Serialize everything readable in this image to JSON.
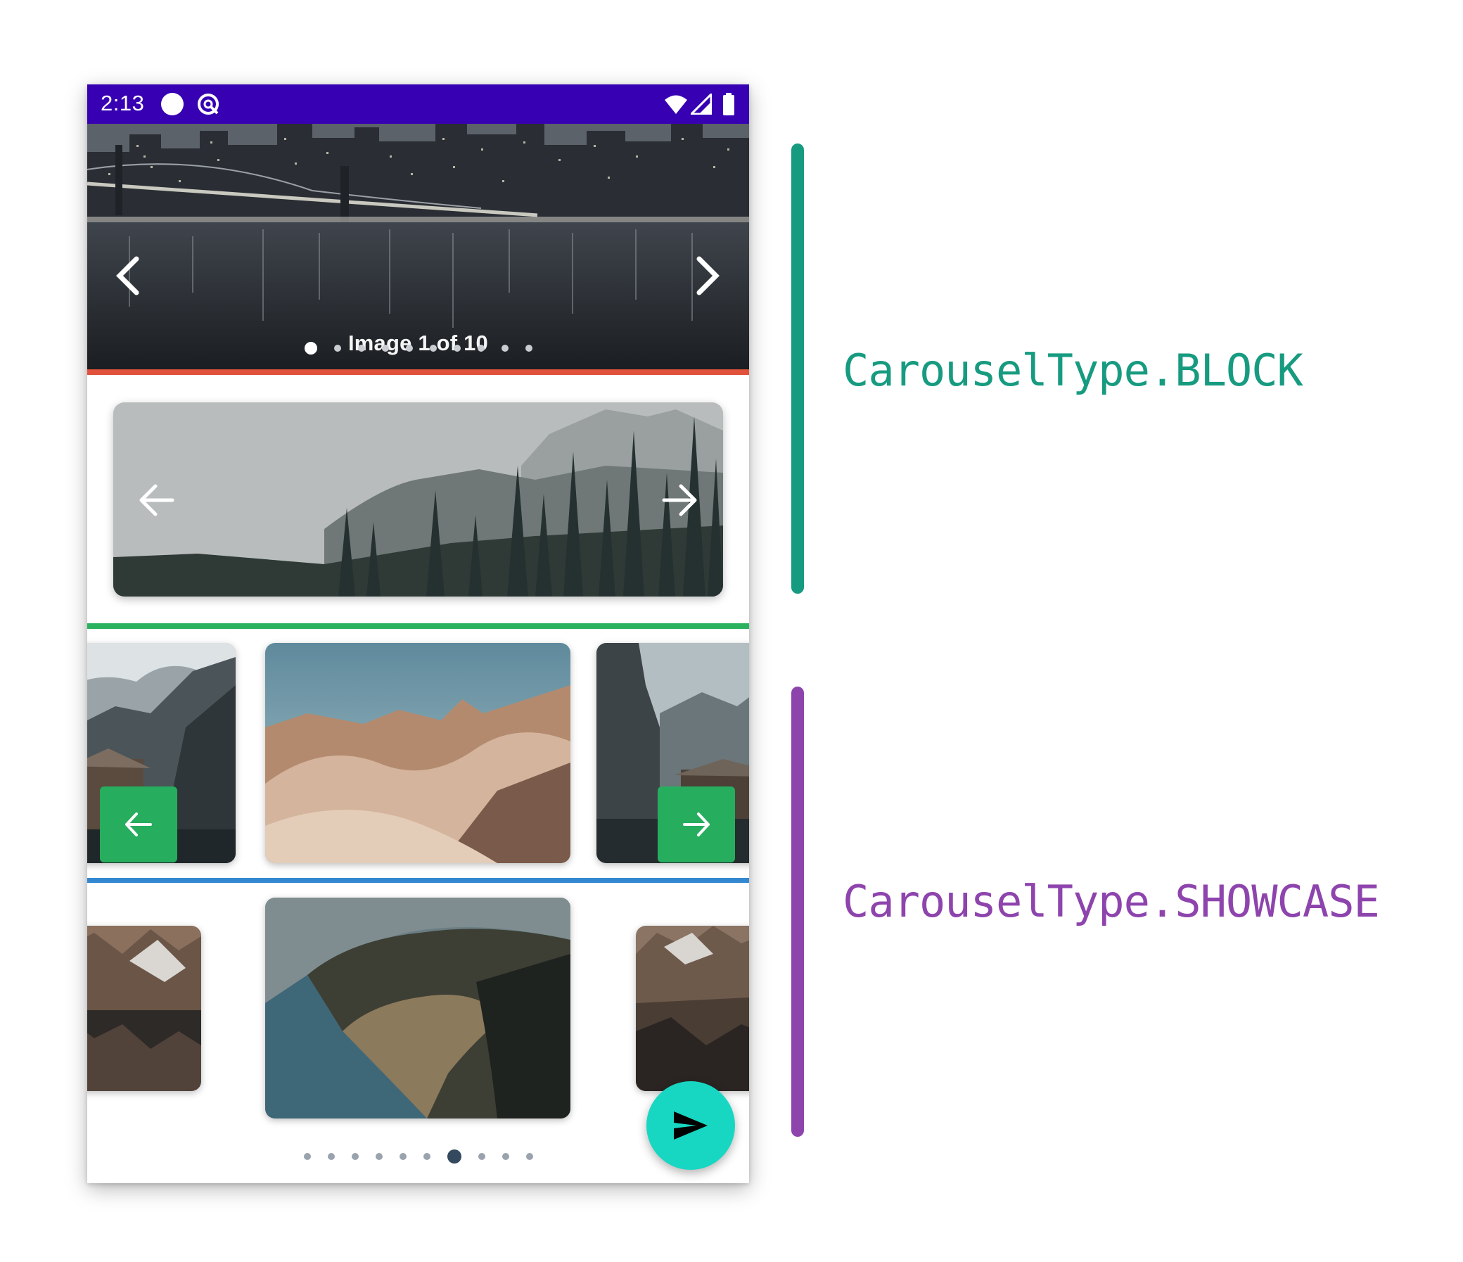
{
  "status_bar": {
    "time": "2:13"
  },
  "carousel_block": {
    "caption": "Image 1 of 10",
    "dot_count": 10,
    "active_index": 0
  },
  "carousel_showcase": {
    "dot_count": 10,
    "active_index": 6
  },
  "annotations": {
    "block_label": "CarouselType.BLOCK",
    "showcase_label": "CarouselType.SHOWCASE"
  },
  "colors": {
    "status_bar": "#3700b3",
    "block_accent": "#179b80",
    "showcase_accent": "#8e44ad",
    "divider_red": "#e1523d",
    "divider_green": "#2bb25f",
    "divider_blue": "#3388d0",
    "nav_button_green": "#27ad5e",
    "fab": "#17d7c2"
  },
  "icons": {
    "prev": "chevron-left-icon",
    "next": "chevron-right-icon",
    "arrow_prev": "arrow-left-icon",
    "arrow_next": "arrow-right-icon",
    "send": "send-icon",
    "wifi": "wifi-icon",
    "signal": "signal-icon",
    "battery": "battery-icon"
  }
}
